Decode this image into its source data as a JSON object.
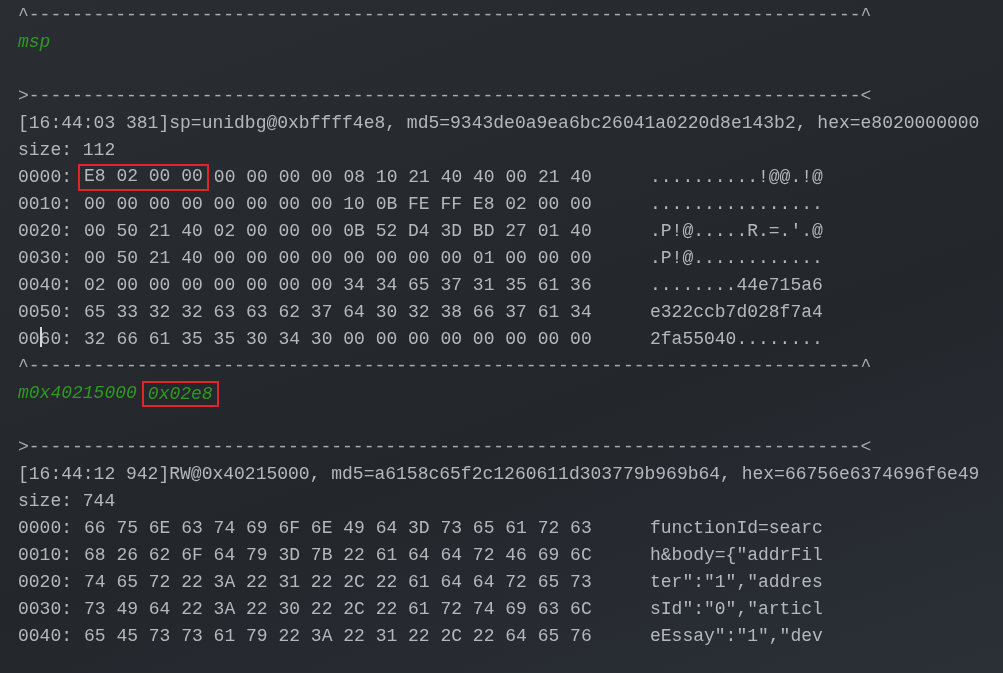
{
  "console": {
    "lines": [
      {
        "kind": "separator",
        "text": "^-----------------------------------------------------------------------------^"
      },
      {
        "kind": "output",
        "segments": [
          {
            "text": "msp",
            "highlighted": false
          }
        ]
      },
      {
        "kind": "blank"
      },
      {
        "kind": "separator",
        "text": ">-----------------------------------------------------------------------------<"
      },
      {
        "kind": "text",
        "text": "[16:44:03 381]sp=unidbg@0xbffff4e8, md5=9343de0a9ea6bc26041a0220d8e143b2, hex=e8020000000"
      },
      {
        "kind": "text",
        "text": "size: 112"
      },
      {
        "kind": "hex",
        "offset": "0000:",
        "cursor": false,
        "bytes": [
          {
            "text": "E8 02 00 00",
            "highlighted": true
          },
          {
            "text": "00 00 00 00 08 10 21 40 40 00 21 40",
            "highlighted": false
          }
        ],
        "ascii": "..........!@@.!@"
      },
      {
        "kind": "hex",
        "offset": "0010:",
        "cursor": false,
        "bytes": [
          {
            "text": "00 00 00 00 00 00 00 00 10 0B FE FF E8 02 00 00",
            "highlighted": false
          }
        ],
        "ascii": "................"
      },
      {
        "kind": "hex",
        "offset": "0020:",
        "cursor": false,
        "bytes": [
          {
            "text": "00 50 21 40 02 00 00 00 0B 52 D4 3D BD 27 01 40",
            "highlighted": false
          }
        ],
        "ascii": ".P!@.....R.=.'.@"
      },
      {
        "kind": "hex",
        "offset": "0030:",
        "cursor": false,
        "bytes": [
          {
            "text": "00 50 21 40 00 00 00 00 00 00 00 00 01 00 00 00",
            "highlighted": false
          }
        ],
        "ascii": ".P!@............"
      },
      {
        "kind": "hex",
        "offset": "0040:",
        "cursor": false,
        "bytes": [
          {
            "text": "02 00 00 00 00 00 00 00 34 34 65 37 31 35 61 36",
            "highlighted": false
          }
        ],
        "ascii": "........44e715a6"
      },
      {
        "kind": "hex",
        "offset": "0050:",
        "cursor": false,
        "bytes": [
          {
            "text": "65 33 32 32 63 63 62 37 64 30 32 38 66 37 61 34",
            "highlighted": false
          }
        ],
        "ascii": "e322ccb7d028f7a4"
      },
      {
        "kind": "hex",
        "offset": "0060:",
        "cursor": true,
        "bytes": [
          {
            "text": "32 66 61 35 35 30 34 30 00 00 00 00 00 00 00 00",
            "highlighted": false
          }
        ],
        "ascii": "2fa55040........"
      },
      {
        "kind": "separator",
        "text": "^-----------------------------------------------------------------------------^"
      },
      {
        "kind": "output",
        "segments": [
          {
            "text": "m0x40215000",
            "highlighted": false
          },
          {
            "text": "0x02e8",
            "highlighted": true
          }
        ]
      },
      {
        "kind": "blank"
      },
      {
        "kind": "separator",
        "text": ">-----------------------------------------------------------------------------<"
      },
      {
        "kind": "text",
        "text": "[16:44:12 942]RW@0x40215000, md5=a6158c65f2c1260611d303779b969b64, hex=66756e6374696f6e49"
      },
      {
        "kind": "text",
        "text": "size: 744"
      },
      {
        "kind": "hex",
        "offset": "0000:",
        "cursor": false,
        "bytes": [
          {
            "text": "66 75 6E 63 74 69 6F 6E 49 64 3D 73 65 61 72 63",
            "highlighted": false
          }
        ],
        "ascii": "functionId=searc"
      },
      {
        "kind": "hex",
        "offset": "0010:",
        "cursor": false,
        "bytes": [
          {
            "text": "68 26 62 6F 64 79 3D 7B 22 61 64 64 72 46 69 6C",
            "highlighted": false
          }
        ],
        "ascii": "h&body={\"addrFil"
      },
      {
        "kind": "hex",
        "offset": "0020:",
        "cursor": false,
        "bytes": [
          {
            "text": "74 65 72 22 3A 22 31 22 2C 22 61 64 64 72 65 73",
            "highlighted": false
          }
        ],
        "ascii": "ter\":\"1\",\"addres"
      },
      {
        "kind": "hex",
        "offset": "0030:",
        "cursor": false,
        "bytes": [
          {
            "text": "73 49 64 22 3A 22 30 22 2C 22 61 72 74 69 63 6C",
            "highlighted": false
          }
        ],
        "ascii": "sId\":\"0\",\"articl"
      },
      {
        "kind": "hex",
        "offset": "0040:",
        "cursor": false,
        "bytes": [
          {
            "text": "65 45 73 73 61 79 22 3A 22 31 22 2C 22 64 65 76",
            "highlighted": false
          }
        ],
        "ascii": "eEssay\":\"1\",\"dev"
      }
    ]
  }
}
